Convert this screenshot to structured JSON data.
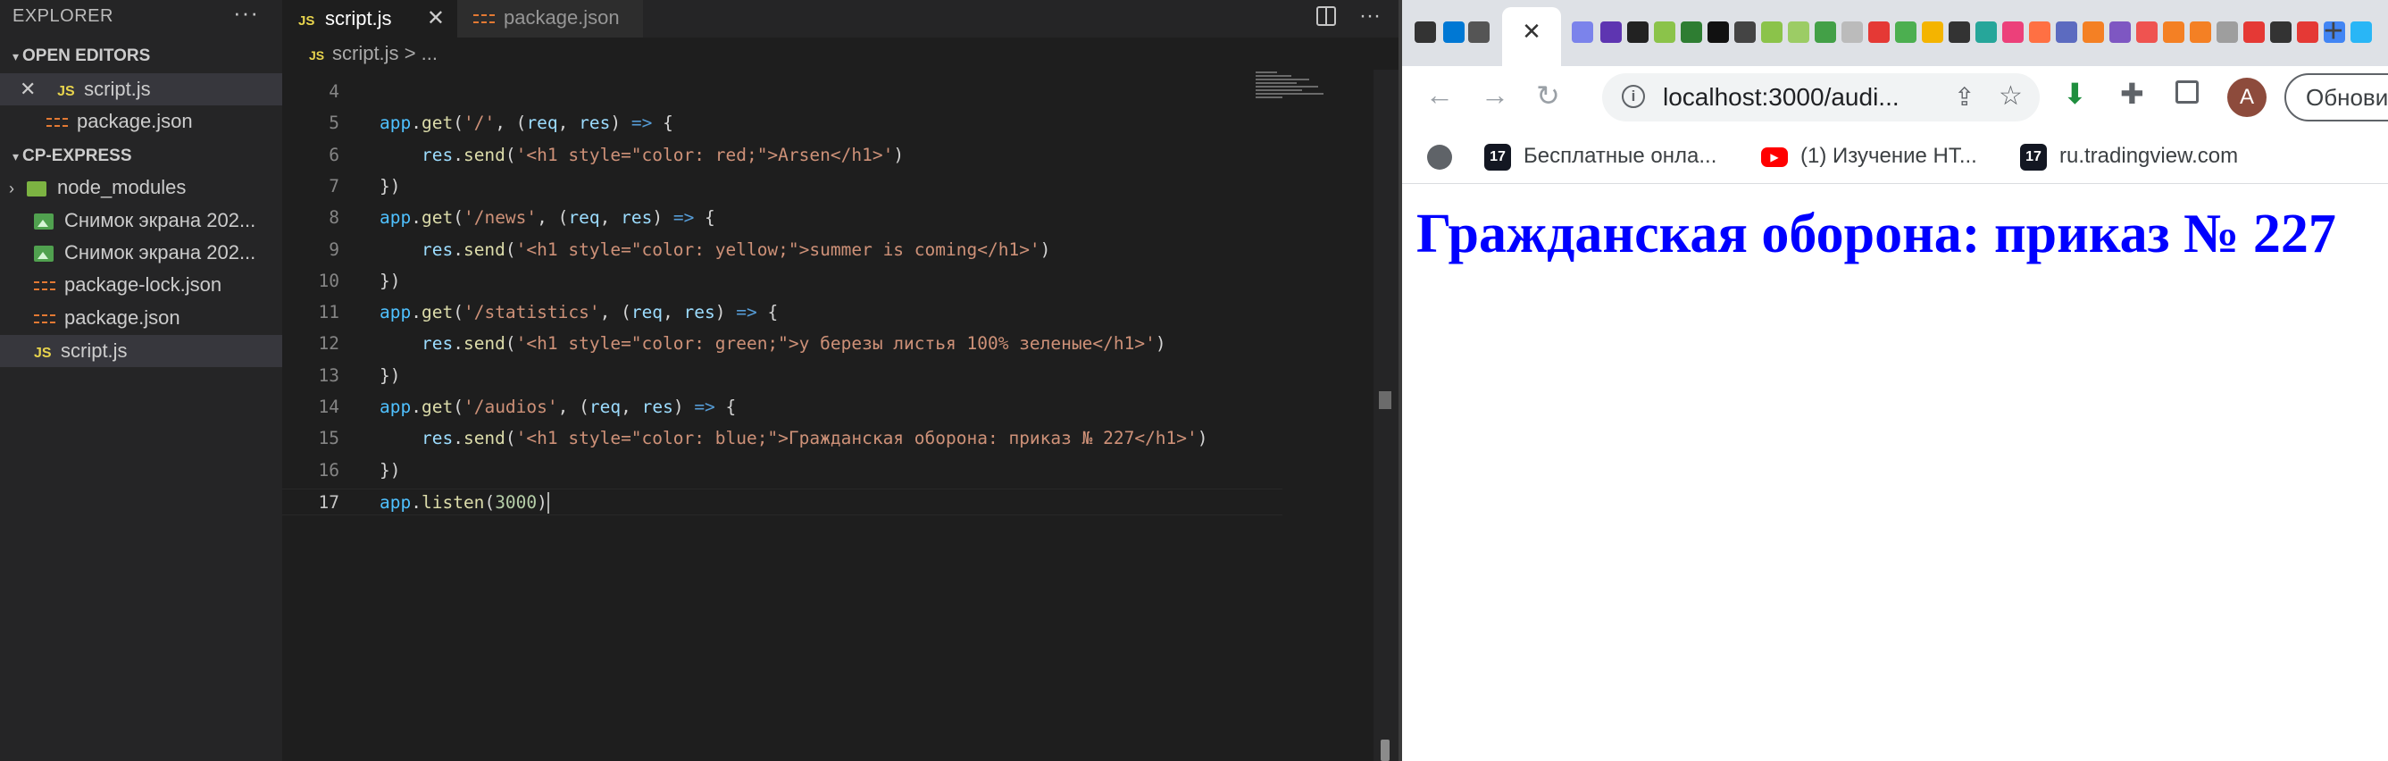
{
  "explorer": {
    "title": "EXPLORER",
    "more": "···",
    "open_editors": {
      "label": "OPEN EDITORS",
      "items": [
        {
          "icon": "JS",
          "name": "script.js"
        },
        {
          "name": "package.json"
        }
      ]
    },
    "project": {
      "label": "CP-EXPRESS",
      "items": [
        {
          "name": "node_modules"
        },
        {
          "name": "Снимок экрана 202..."
        },
        {
          "name": "Снимок экрана 202..."
        },
        {
          "name": "package-lock.json"
        },
        {
          "name": "package.json"
        },
        {
          "icon": "JS",
          "name": "script.js"
        }
      ]
    }
  },
  "tabs": [
    {
      "icon": "JS",
      "label": "script.js",
      "active": true
    },
    {
      "label": "package.json",
      "active": false
    }
  ],
  "breadcrumb": {
    "icon": "JS",
    "file": "script.js",
    "separator": ">",
    "rest": "..."
  },
  "code": {
    "lines": [
      {
        "n": "4",
        "tokens": []
      },
      {
        "n": "5",
        "tokens": [
          [
            "var",
            "app"
          ],
          [
            "p",
            "."
          ],
          [
            "fn",
            "get"
          ],
          [
            "p",
            "("
          ],
          [
            "str",
            "'/'"
          ],
          [
            "p",
            ", ("
          ],
          [
            "par",
            "req"
          ],
          [
            "p",
            ", "
          ],
          [
            "par",
            "res"
          ],
          [
            "p",
            ") "
          ],
          [
            "kw",
            "=>"
          ],
          [
            "p",
            " {"
          ]
        ]
      },
      {
        "n": "6",
        "tokens": [
          [
            "p",
            "    "
          ],
          [
            "par",
            "res"
          ],
          [
            "p",
            "."
          ],
          [
            "fn",
            "send"
          ],
          [
            "p",
            "("
          ],
          [
            "str",
            "'<h1 style=\"color: red;\">Arsen</h1>'"
          ],
          [
            "p",
            ")"
          ]
        ]
      },
      {
        "n": "7",
        "tokens": [
          [
            "p",
            "})"
          ]
        ]
      },
      {
        "n": "8",
        "tokens": [
          [
            "var",
            "app"
          ],
          [
            "p",
            "."
          ],
          [
            "fn",
            "get"
          ],
          [
            "p",
            "("
          ],
          [
            "str",
            "'/news'"
          ],
          [
            "p",
            ", ("
          ],
          [
            "par",
            "req"
          ],
          [
            "p",
            ", "
          ],
          [
            "par",
            "res"
          ],
          [
            "p",
            ") "
          ],
          [
            "kw",
            "=>"
          ],
          [
            "p",
            " {"
          ]
        ]
      },
      {
        "n": "9",
        "tokens": [
          [
            "p",
            "    "
          ],
          [
            "par",
            "res"
          ],
          [
            "p",
            "."
          ],
          [
            "fn",
            "send"
          ],
          [
            "p",
            "("
          ],
          [
            "str",
            "'<h1 style=\"color: yellow;\">summer is coming</h1>'"
          ],
          [
            "p",
            ")"
          ]
        ]
      },
      {
        "n": "10",
        "tokens": [
          [
            "p",
            "})"
          ]
        ]
      },
      {
        "n": "11",
        "tokens": [
          [
            "var",
            "app"
          ],
          [
            "p",
            "."
          ],
          [
            "fn",
            "get"
          ],
          [
            "p",
            "("
          ],
          [
            "str",
            "'/statistics'"
          ],
          [
            "p",
            ", ("
          ],
          [
            "par",
            "req"
          ],
          [
            "p",
            ", "
          ],
          [
            "par",
            "res"
          ],
          [
            "p",
            ") "
          ],
          [
            "kw",
            "=>"
          ],
          [
            "p",
            " {"
          ]
        ]
      },
      {
        "n": "12",
        "tokens": [
          [
            "p",
            "    "
          ],
          [
            "par",
            "res"
          ],
          [
            "p",
            "."
          ],
          [
            "fn",
            "send"
          ],
          [
            "p",
            "("
          ],
          [
            "str",
            "'<h1 style=\"color: green;\">у березы листья 100% зеленые</h1>'"
          ],
          [
            "p",
            ")"
          ]
        ]
      },
      {
        "n": "13",
        "tokens": [
          [
            "p",
            "})"
          ]
        ]
      },
      {
        "n": "14",
        "tokens": [
          [
            "var",
            "app"
          ],
          [
            "p",
            "."
          ],
          [
            "fn",
            "get"
          ],
          [
            "p",
            "("
          ],
          [
            "str",
            "'/audios'"
          ],
          [
            "p",
            ", ("
          ],
          [
            "par",
            "req"
          ],
          [
            "p",
            ", "
          ],
          [
            "par",
            "res"
          ],
          [
            "p",
            ") "
          ],
          [
            "kw",
            "=>"
          ],
          [
            "p",
            " {"
          ]
        ]
      },
      {
        "n": "15",
        "tokens": [
          [
            "p",
            "    "
          ],
          [
            "par",
            "res"
          ],
          [
            "p",
            "."
          ],
          [
            "fn",
            "send"
          ],
          [
            "p",
            "("
          ],
          [
            "str",
            "'<h1 style=\"color: blue;\">Гражданская оборона: приказ № 227</h1>'"
          ],
          [
            "p",
            ")"
          ]
        ]
      },
      {
        "n": "16",
        "tokens": [
          [
            "p",
            "})"
          ]
        ]
      },
      {
        "n": "17",
        "tokens": [
          [
            "var",
            "app"
          ],
          [
            "p",
            "."
          ],
          [
            "fn",
            "listen"
          ],
          [
            "p",
            "("
          ],
          [
            "num",
            "3000"
          ],
          [
            "p",
            ")"
          ]
        ]
      }
    ],
    "current_line": "17"
  },
  "browser": {
    "active_tab_close": "✕",
    "new_tab": "+",
    "url": "localhost:3000/audi...",
    "avatar_letter": "A",
    "update_label": "Обнови",
    "bookmarks": [
      {
        "label": "Бесплатные онла..."
      },
      {
        "label": "(1) Изучение НТ..."
      },
      {
        "label": "ru.tradingview.com"
      }
    ],
    "page_heading": "Гражданская оборона: приказ № 227",
    "page_heading_color": "#0000ff"
  },
  "colors": {
    "editor_bg": "#1e1e1e",
    "sidebar_bg": "#252526",
    "string": "#ce9178",
    "keyword": "#569cd6",
    "variable": "#4fc1ff",
    "function": "#dcdcaa",
    "param": "#9cdcfe",
    "number": "#b5cea8"
  }
}
